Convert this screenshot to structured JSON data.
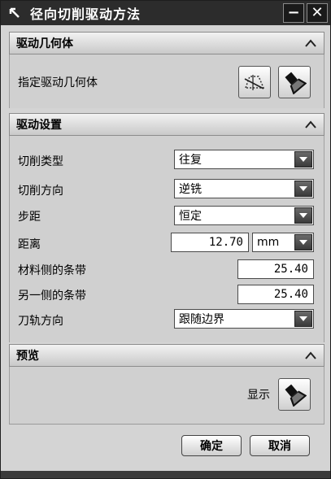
{
  "window": {
    "title": "径向切削驱动方法",
    "minimize_label": "−",
    "close_label": "✕"
  },
  "drive_geometry": {
    "header": "驱动几何体",
    "specify_label": "指定驱动几何体"
  },
  "drive_settings": {
    "header": "驱动设置",
    "cut_type_label": "切削类型",
    "cut_type_value": "往复",
    "cut_direction_label": "切削方向",
    "cut_direction_value": "逆铣",
    "stepover_label": "步距",
    "stepover_value": "恒定",
    "distance_label": "距离",
    "distance_value": "12.70",
    "distance_unit": "mm",
    "material_side_label": "材料侧的条带",
    "material_side_value": "25.40",
    "other_side_label": "另一侧的条带",
    "other_side_value": "25.40",
    "tool_path_dir_label": "刀轨方向",
    "tool_path_dir_value": "跟随边界"
  },
  "preview": {
    "header": "预览",
    "display_label": "显示"
  },
  "footer": {
    "ok_label": "确定",
    "cancel_label": "取消"
  }
}
